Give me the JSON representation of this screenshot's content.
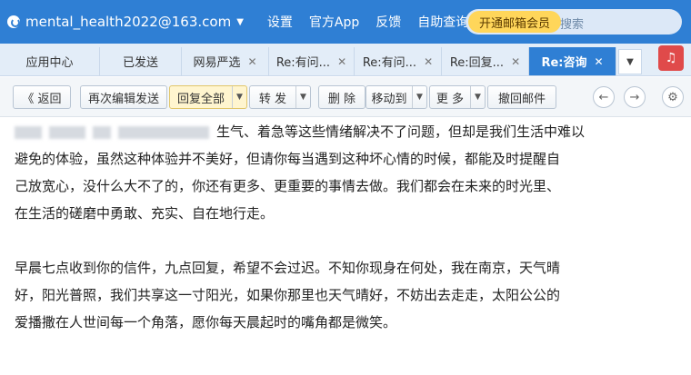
{
  "header": {
    "account": "mental_health2022@163.com",
    "nav": [
      "设置",
      "官方App",
      "反馈",
      "自助查询"
    ],
    "vip_label": "开通邮箱会员",
    "search_placeholder": "搜索"
  },
  "tabs": [
    {
      "label": "应用中心",
      "closable": false
    },
    {
      "label": "已发送",
      "closable": false
    },
    {
      "label": "网易严选",
      "closable": true
    },
    {
      "label": "Re:有问...",
      "closable": true
    },
    {
      "label": "Re:有问...",
      "closable": true
    },
    {
      "label": "Re:回复...",
      "closable": true
    },
    {
      "label": "Re:咨询",
      "closable": true,
      "active": true
    }
  ],
  "toolbar": {
    "back": "《 返回",
    "reedit": "再次编辑发送",
    "reply_all": "回复全部",
    "forward": "转 发",
    "delete": "删 除",
    "move_to": "移动到",
    "more": "更 多",
    "recall": "撤回邮件"
  },
  "body": {
    "para1_line1": "生气、着急等这些情绪解决不了问题，但却是我们生活中难以",
    "para1_line2": "避免的体验，虽然这种体验并不美好，但请你每当遇到这种坏心情的时候，都能及时提醒自",
    "para1_line3": "己放宽心，没什么大不了的，你还有更多、更重要的事情去做。我们都会在未来的时光里、",
    "para1_line4": "在生活的磋磨中勇敢、充实、自在地行走。",
    "para2_line1": "早晨七点收到你的信件，九点回复，希望不会过迟。不知你现身在何处，我在南京，天气晴",
    "para2_line2": "好，阳光普照，我们共享这一寸阳光，如果你那里也天气晴好，不妨出去走走，太阳公公的",
    "para2_line3": "爱播撒在人世间每一个角落，愿你每天晨起时的嘴角都是微笑。"
  },
  "colors": {
    "header_blue": "#2f7fd4",
    "vip_yellow": "#ffd65a",
    "tab_bg": "#e3edf8"
  }
}
